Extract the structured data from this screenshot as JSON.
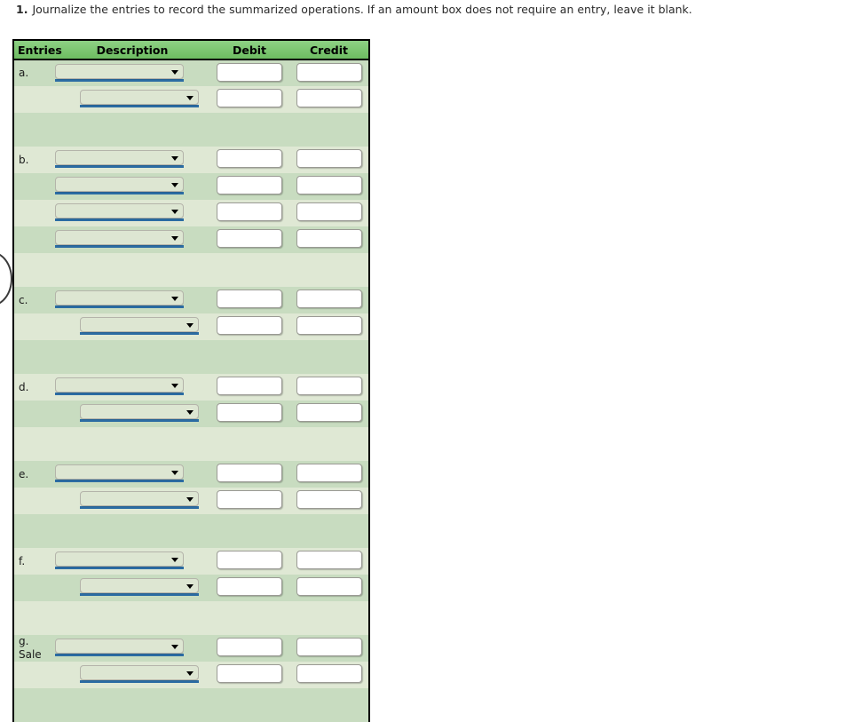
{
  "prompt": {
    "number": "1.",
    "text": "Journalize the entries to record the summarized operations. If an amount box does not require an entry, leave it blank."
  },
  "table": {
    "headers": {
      "entries": "Entries",
      "description": "Description",
      "debit": "Debit",
      "credit": "Credit"
    },
    "colors": {
      "header_green": "#74c36a",
      "row_dark": "#c8dcc0",
      "row_light": "#dfe8d4",
      "dropdown_fill": "#dde6d2",
      "dropdown_underline": "#2b6ca3",
      "amount_fill": "#ffffff",
      "border": "#000000"
    },
    "groups": [
      {
        "label_lines": [
          "a."
        ],
        "rows": [
          {
            "indent": false,
            "dropdown_value": "",
            "debit_value": "",
            "credit_value": ""
          },
          {
            "indent": true,
            "dropdown_value": "",
            "debit_value": "",
            "credit_value": ""
          }
        ]
      },
      {
        "label_lines": [
          "b."
        ],
        "rows": [
          {
            "indent": false,
            "dropdown_value": "",
            "debit_value": "",
            "credit_value": ""
          },
          {
            "indent": false,
            "dropdown_value": "",
            "debit_value": "",
            "credit_value": ""
          },
          {
            "indent": false,
            "dropdown_value": "",
            "debit_value": "",
            "credit_value": ""
          },
          {
            "indent": false,
            "dropdown_value": "",
            "debit_value": "",
            "credit_value": ""
          }
        ]
      },
      {
        "label_lines": [
          "c."
        ],
        "rows": [
          {
            "indent": false,
            "dropdown_value": "",
            "debit_value": "",
            "credit_value": ""
          },
          {
            "indent": true,
            "dropdown_value": "",
            "debit_value": "",
            "credit_value": ""
          }
        ]
      },
      {
        "label_lines": [
          "d."
        ],
        "rows": [
          {
            "indent": false,
            "dropdown_value": "",
            "debit_value": "",
            "credit_value": ""
          },
          {
            "indent": true,
            "dropdown_value": "",
            "debit_value": "",
            "credit_value": ""
          }
        ]
      },
      {
        "label_lines": [
          "e."
        ],
        "rows": [
          {
            "indent": false,
            "dropdown_value": "",
            "debit_value": "",
            "credit_value": ""
          },
          {
            "indent": true,
            "dropdown_value": "",
            "debit_value": "",
            "credit_value": ""
          }
        ]
      },
      {
        "label_lines": [
          "f."
        ],
        "rows": [
          {
            "indent": false,
            "dropdown_value": "",
            "debit_value": "",
            "credit_value": ""
          },
          {
            "indent": true,
            "dropdown_value": "",
            "debit_value": "",
            "credit_value": ""
          }
        ]
      },
      {
        "label_lines": [
          "g.",
          "Sale"
        ],
        "rows": [
          {
            "indent": false,
            "dropdown_value": "",
            "debit_value": "",
            "credit_value": ""
          },
          {
            "indent": true,
            "dropdown_value": "",
            "debit_value": "",
            "credit_value": ""
          }
        ]
      }
    ]
  }
}
